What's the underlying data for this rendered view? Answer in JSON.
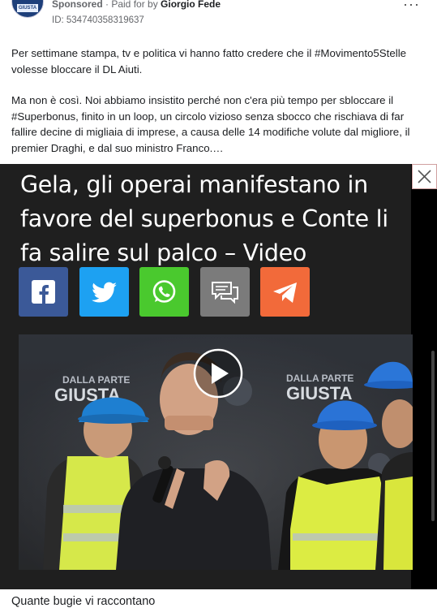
{
  "post": {
    "sponsored_label": "Sponsored",
    "paid_for_prefix": " · Paid for by ",
    "advertiser": "Giorgio Fede",
    "ad_id": "ID: 534740358319637",
    "more_label": "···",
    "avatar_text": "GIUSTA",
    "paragraph_1": "Per settimane stampa, tv e politica vi hanno fatto credere che il #Movimento5Stelle volesse bloccare il DL Aiuti.",
    "paragraph_2": "Ma non è così. Noi abbiamo insistito perché non c'era più tempo per sbloccare il #Superbonus, finito in un loop, un circolo vizioso senza sbocco che rischiava di far fallire decine di migliaia di imprese, a causa delle 14 modifiche volute dal migliore, il premier Draghi, e dal suo ministro Franco.…"
  },
  "media": {
    "headline": "Gela, gli operai manifestano in favore del superbonus e Conte li fa salire sul palco – Video",
    "share_buttons": [
      {
        "name": "facebook",
        "icon": "facebook-icon",
        "color": "#3b5998"
      },
      {
        "name": "twitter",
        "icon": "twitter-icon",
        "color": "#1da1f2"
      },
      {
        "name": "whatsapp",
        "icon": "whatsapp-icon",
        "color": "#4ac92e"
      },
      {
        "name": "sms",
        "icon": "chat-bubbles-icon",
        "color": "#7b7b7b"
      },
      {
        "name": "telegram",
        "icon": "telegram-icon",
        "color": "#f26a3a"
      }
    ],
    "backdrop_text_left_small": "DALLA PARTE",
    "backdrop_text_left_big": "GIUSTA",
    "backdrop_text_right_small": "DALLA PARTE",
    "backdrop_text_right_big": "GIUSTA",
    "play_icon": "play-icon",
    "close_icon": "close-icon"
  },
  "caption": "Quante bugie vi raccontano"
}
